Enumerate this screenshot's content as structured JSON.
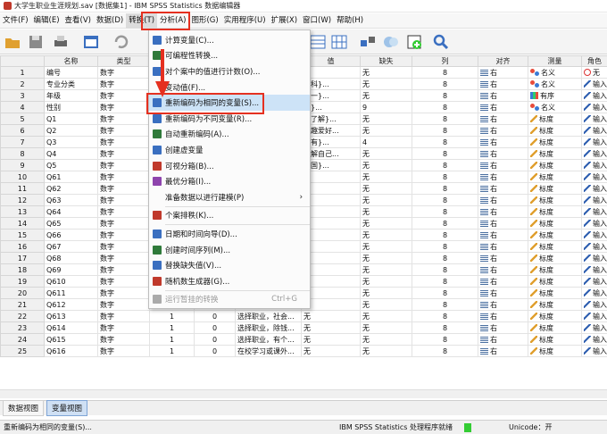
{
  "window_title": "大学生职业生涯规划.sav [数据集1] - IBM SPSS Statistics 数据编辑器",
  "menu": [
    "文件(F)",
    "编辑(E)",
    "查看(V)",
    "数据(D)",
    "转换(T)",
    "分析(A)",
    "图形(G)",
    "实用程序(U)",
    "扩展(X)",
    "窗口(W)",
    "帮助(H)"
  ],
  "columns": [
    "名称",
    "类型",
    "",
    "",
    "",
    "值",
    "缺失",
    "列",
    "对齐",
    "测量",
    "角色"
  ],
  "rows": [
    {
      "n": "1",
      "name": "编号",
      "type": "数字",
      "w": "",
      "d": "",
      "label": "",
      "value": "无",
      "missing": "无",
      "col": "8",
      "align": "右",
      "measure": "名义",
      "role": "无"
    },
    {
      "n": "2",
      "name": "专业分类",
      "type": "数字",
      "w": "",
      "d": "",
      "label": "",
      "value": "理科}...",
      "missing": "无",
      "col": "8",
      "align": "右",
      "measure": "名义",
      "role": "输入"
    },
    {
      "n": "3",
      "name": "年级",
      "type": "数字",
      "w": "",
      "d": "",
      "label": "",
      "value": "大一}...",
      "missing": "无",
      "col": "8",
      "align": "右",
      "measure": "有序",
      "role": "输入"
    },
    {
      "n": "4",
      "name": "性别",
      "type": "数字",
      "w": "",
      "d": "",
      "label": "",
      "value": "男}...",
      "missing": "9",
      "col": "8",
      "align": "右",
      "measure": "名义",
      "role": "输入"
    },
    {
      "n": "5",
      "name": "Q1",
      "type": "数字",
      "w": "",
      "d": "",
      "label": "",
      "value": "常了解}...",
      "missing": "无",
      "col": "8",
      "align": "右",
      "measure": "标度",
      "role": "输入"
    },
    {
      "n": "6",
      "name": "Q2",
      "type": "数字",
      "w": "",
      "d": "",
      "label": "",
      "value": "兴趣爱好...",
      "missing": "无",
      "col": "8",
      "align": "右",
      "measure": "标度",
      "role": "输入"
    },
    {
      "n": "7",
      "name": "Q3",
      "type": "数字",
      "w": "",
      "d": "",
      "label": "",
      "value": "没有}...",
      "missing": "4",
      "col": "8",
      "align": "右",
      "measure": "标度",
      "role": "输入"
    },
    {
      "n": "8",
      "name": "Q4",
      "type": "数字",
      "w": "",
      "d": "",
      "label": "",
      "value": "了解自己...",
      "missing": "无",
      "col": "8",
      "align": "右",
      "measure": "标度",
      "role": "输入"
    },
    {
      "n": "9",
      "name": "Q5",
      "type": "数字",
      "w": "",
      "d": "",
      "label": "",
      "value": "出国}...",
      "missing": "无",
      "col": "8",
      "align": "右",
      "measure": "标度",
      "role": "输入"
    },
    {
      "n": "10",
      "name": "Q61",
      "type": "数字",
      "w": "",
      "d": "",
      "label": "",
      "value": "",
      "missing": "无",
      "col": "8",
      "align": "右",
      "measure": "标度",
      "role": "输入"
    },
    {
      "n": "11",
      "name": "Q62",
      "type": "数字",
      "w": "",
      "d": "",
      "label": "",
      "value": "",
      "missing": "无",
      "col": "8",
      "align": "右",
      "measure": "标度",
      "role": "输入"
    },
    {
      "n": "12",
      "name": "Q63",
      "type": "数字",
      "w": "",
      "d": "",
      "label": "",
      "value": "",
      "missing": "无",
      "col": "8",
      "align": "右",
      "measure": "标度",
      "role": "输入"
    },
    {
      "n": "13",
      "name": "Q64",
      "type": "数字",
      "w": "",
      "d": "",
      "label": "",
      "value": "",
      "missing": "无",
      "col": "8",
      "align": "右",
      "measure": "标度",
      "role": "输入"
    },
    {
      "n": "14",
      "name": "Q65",
      "type": "数字",
      "w": "",
      "d": "",
      "label": "",
      "value": "",
      "missing": "无",
      "col": "8",
      "align": "右",
      "measure": "标度",
      "role": "输入"
    },
    {
      "n": "15",
      "name": "Q66",
      "type": "数字",
      "w": "",
      "d": "",
      "label": "",
      "value": "",
      "missing": "无",
      "col": "8",
      "align": "右",
      "measure": "标度",
      "role": "输入"
    },
    {
      "n": "16",
      "name": "Q67",
      "type": "数字",
      "w": "",
      "d": "",
      "label": "",
      "value": "",
      "missing": "无",
      "col": "8",
      "align": "右",
      "measure": "标度",
      "role": "输入"
    },
    {
      "n": "17",
      "name": "Q68",
      "type": "数字",
      "w": "",
      "d": "",
      "label": "",
      "value": "",
      "missing": "无",
      "col": "8",
      "align": "右",
      "measure": "标度",
      "role": "输入"
    },
    {
      "n": "18",
      "name": "Q69",
      "type": "数字",
      "w": "",
      "d": "",
      "label": "",
      "value": "",
      "missing": "无",
      "col": "8",
      "align": "右",
      "measure": "标度",
      "role": "输入"
    },
    {
      "n": "19",
      "name": "Q610",
      "type": "数字",
      "w": "1",
      "d": "0",
      "label": "对现在毕业生求...",
      "value": "无",
      "missing": "无",
      "col": "8",
      "align": "右",
      "measure": "标度",
      "role": "输入"
    },
    {
      "n": "20",
      "name": "Q611",
      "type": "数字",
      "w": "1",
      "d": "0",
      "label": "选择职业，每个...",
      "value": "无",
      "missing": "无",
      "col": "8",
      "align": "右",
      "measure": "标度",
      "role": "输入"
    },
    {
      "n": "21",
      "name": "Q612",
      "type": "数字",
      "w": "1",
      "d": "0",
      "label": "选择职业，专业...",
      "value": "无",
      "missing": "无",
      "col": "8",
      "align": "右",
      "measure": "标度",
      "role": "输入"
    },
    {
      "n": "22",
      "name": "Q613",
      "type": "数字",
      "w": "1",
      "d": "0",
      "label": "选择职业，社会...",
      "value": "无",
      "missing": "无",
      "col": "8",
      "align": "右",
      "measure": "标度",
      "role": "输入"
    },
    {
      "n": "23",
      "name": "Q614",
      "type": "数字",
      "w": "1",
      "d": "0",
      "label": "选择职业，除钱...",
      "value": "无",
      "missing": "无",
      "col": "8",
      "align": "右",
      "measure": "标度",
      "role": "输入"
    },
    {
      "n": "24",
      "name": "Q615",
      "type": "数字",
      "w": "1",
      "d": "0",
      "label": "选择职业，有个...",
      "value": "无",
      "missing": "无",
      "col": "8",
      "align": "右",
      "measure": "标度",
      "role": "输入"
    },
    {
      "n": "25",
      "name": "Q616",
      "type": "数字",
      "w": "1",
      "d": "0",
      "label": "在校学习或课外...",
      "value": "无",
      "missing": "无",
      "col": "8",
      "align": "右",
      "measure": "标度",
      "role": "输入"
    }
  ],
  "dropdown": [
    {
      "label": "计算变量(C)...",
      "icon": "calc-icon",
      "color": "#3a6fc0"
    },
    {
      "label": "可编程性转换...",
      "icon": "prog-icon",
      "color": "#2f7a3a"
    },
    {
      "label": "对个案中的值进行计数(O)...",
      "icon": "count-icon",
      "color": "#3a6fc0"
    },
    {
      "label": "变动值(F)...",
      "icon": "",
      "color": ""
    },
    {
      "label": "重新编码为相同的变量(S)...",
      "icon": "recode-same-icon",
      "color": "#3a6fc0",
      "highlight": true
    },
    {
      "label": "重新编码为不同变量(R)...",
      "icon": "recode-diff-icon",
      "color": "#3a6fc0"
    },
    {
      "label": "自动重新编码(A)...",
      "icon": "auto-recode-icon",
      "color": "#2f7a3a"
    },
    {
      "label": "创建虚变量",
      "icon": "dummy-icon",
      "color": "#3a6fc0"
    },
    {
      "label": "可视分箱(B)...",
      "icon": "visual-bin-icon",
      "color": "#c0392b"
    },
    {
      "label": "最优分箱(I)...",
      "icon": "optimal-bin-icon",
      "color": "#8e44ad"
    },
    {
      "label": "准备数据以进行建模(P)",
      "icon": "",
      "color": "",
      "sub": true,
      "sep_after": true
    },
    {
      "label": "个案排秩(K)...",
      "icon": "rank-icon",
      "color": "#c0392b",
      "sep_after": true
    },
    {
      "label": "日期和时间向导(D)...",
      "icon": "date-icon",
      "color": "#3a6fc0"
    },
    {
      "label": "创建时间序列(M)...",
      "icon": "timeseries-icon",
      "color": "#2f7a3a"
    },
    {
      "label": "替换缺失值(V)...",
      "icon": "replace-missing-icon",
      "color": "#3a6fc0"
    },
    {
      "label": "随机数生成器(G)...",
      "icon": "random-icon",
      "color": "#c0392b",
      "sep_after": true
    },
    {
      "label": "运行暂挂的转换",
      "icon": "run-pending-icon",
      "color": "#aaaaaa",
      "disabled": true,
      "shortcut": "Ctrl+G"
    }
  ],
  "tabs": [
    "数据视图",
    "变量视图"
  ],
  "status": {
    "left": "重新编码为相同的变量(S)...",
    "processor": "IBM SPSS Statistics 处理程序就绪",
    "unicode": "Unicode：开"
  },
  "colors": {
    "highlight_border": "#e53020",
    "menu_highlight": "#cde3f7"
  }
}
